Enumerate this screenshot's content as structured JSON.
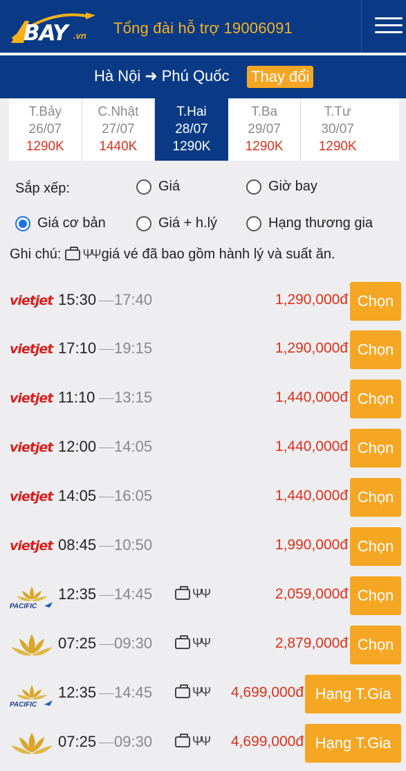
{
  "header": {
    "logo_text": "BAY",
    "logo_suffix": ".vn",
    "hotline": "Tổng đài hỗ trợ 19006091",
    "menu_icon": "hamburger-icon"
  },
  "route": {
    "from": "Hà Nội",
    "to": "Phú Quốc",
    "change_label": "Thay đổi"
  },
  "dates": [
    {
      "day": "T.Bảy",
      "date": "26/07",
      "price": "1290K",
      "active": false
    },
    {
      "day": "C.Nhật",
      "date": "27/07",
      "price": "1440K",
      "active": false
    },
    {
      "day": "T.Hai",
      "date": "28/07",
      "price": "1290K",
      "active": true
    },
    {
      "day": "T.Ba",
      "date": "29/07",
      "price": "1290K",
      "active": false
    },
    {
      "day": "T.Tư",
      "date": "30/07",
      "price": "1290K",
      "active": false
    }
  ],
  "sort": {
    "label": "Sắp xếp:",
    "options": [
      "Giá",
      "Giờ bay",
      "Giá cơ bản",
      "Giá + h.lý",
      "Hạng thương gia"
    ],
    "selected": "Giá cơ bản"
  },
  "note": {
    "prefix": "Ghi chú:",
    "text": "giá vé đã bao gồm hành lý và suất ăn."
  },
  "flights": [
    {
      "airline": "vietjet",
      "airline_text": "vietjet",
      "dep": "15:30",
      "arr": "17:40",
      "included": false,
      "price": "1,290,000đ",
      "action": "Chọn"
    },
    {
      "airline": "vietjet",
      "airline_text": "vietjet",
      "dep": "17:10",
      "arr": "19:15",
      "included": false,
      "price": "1,290,000đ",
      "action": "Chọn"
    },
    {
      "airline": "vietjet",
      "airline_text": "vietjet",
      "dep": "11:10",
      "arr": "13:15",
      "included": false,
      "price": "1,440,000đ",
      "action": "Chọn"
    },
    {
      "airline": "vietjet",
      "airline_text": "vietjet",
      "dep": "12:00",
      "arr": "14:05",
      "included": false,
      "price": "1,440,000đ",
      "action": "Chọn"
    },
    {
      "airline": "vietjet",
      "airline_text": "vietjet",
      "dep": "14:05",
      "arr": "16:05",
      "included": false,
      "price": "1,440,000đ",
      "action": "Chọn"
    },
    {
      "airline": "vietjet",
      "airline_text": "vietjet",
      "dep": "08:45",
      "arr": "10:50",
      "included": false,
      "price": "1,990,000đ",
      "action": "Chọn"
    },
    {
      "airline": "pacific",
      "airline_text": "PACIFIC",
      "dep": "12:35",
      "arr": "14:45",
      "included": true,
      "price": "2,059,000đ",
      "action": "Chọn"
    },
    {
      "airline": "vietnam-airlines",
      "airline_text": "",
      "dep": "07:25",
      "arr": "09:30",
      "included": true,
      "price": "2,879,000đ",
      "action": "Chọn"
    },
    {
      "airline": "pacific",
      "airline_text": "PACIFIC",
      "dep": "12:35",
      "arr": "14:45",
      "included": true,
      "price": "4,699,000đ",
      "action": "Hạng T.Gia"
    },
    {
      "airline": "vietnam-airlines",
      "airline_text": "",
      "dep": "07:25",
      "arr": "09:30",
      "included": true,
      "price": "4,699,000đ",
      "action": "Hạng T.Gia"
    }
  ],
  "colors": {
    "header_blue": "#0a3a86",
    "accent_orange": "#f5a623",
    "price_red": "#d9321c",
    "lotus_gold": "#d9a72b"
  }
}
